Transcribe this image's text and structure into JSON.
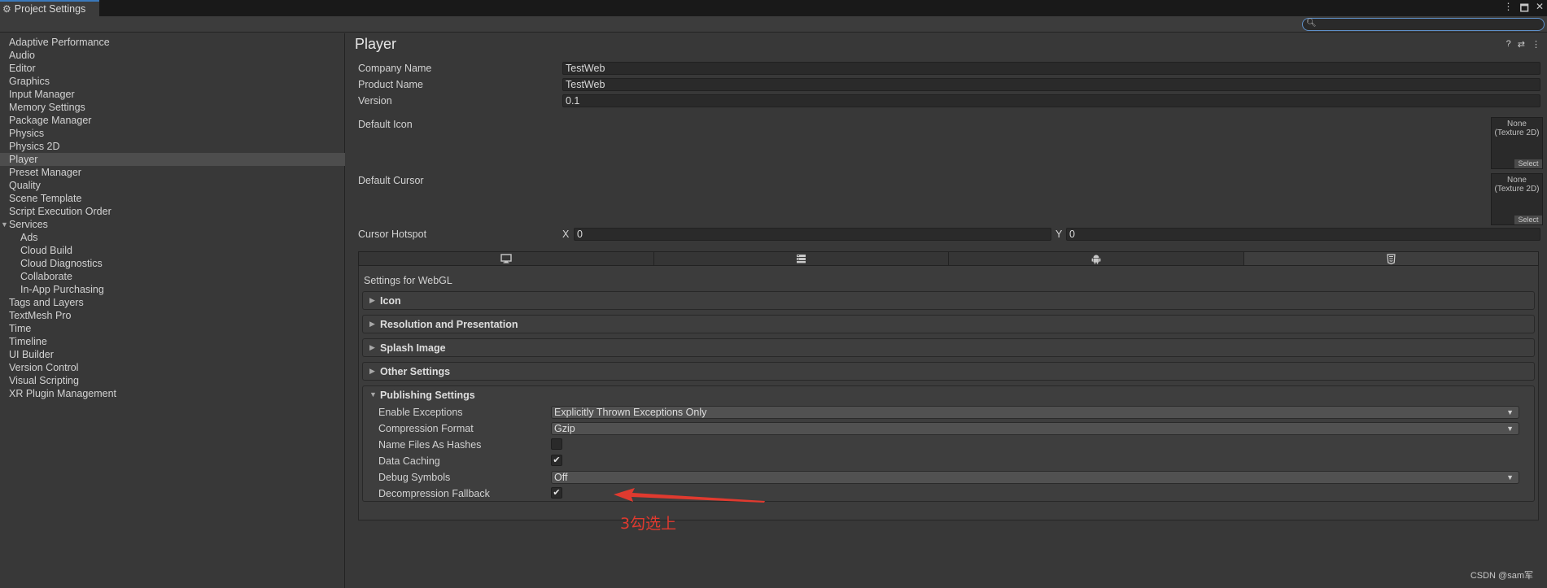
{
  "window": {
    "tab_title": "Project Settings",
    "controls": [
      "⋮",
      "🗖",
      "✕"
    ]
  },
  "search": {
    "placeholder": ""
  },
  "sidebar": {
    "items": [
      {
        "label": "Adaptive Performance"
      },
      {
        "label": "Audio"
      },
      {
        "label": "Editor"
      },
      {
        "label": "Graphics"
      },
      {
        "label": "Input Manager"
      },
      {
        "label": "Memory Settings"
      },
      {
        "label": "Package Manager"
      },
      {
        "label": "Physics"
      },
      {
        "label": "Physics 2D"
      },
      {
        "label": "Player",
        "selected": true
      },
      {
        "label": "Preset Manager"
      },
      {
        "label": "Quality"
      },
      {
        "label": "Scene Template"
      },
      {
        "label": "Script Execution Order"
      },
      {
        "label": "Services",
        "expanded": true
      },
      {
        "label": "Ads",
        "child": true
      },
      {
        "label": "Cloud Build",
        "child": true
      },
      {
        "label": "Cloud Diagnostics",
        "child": true
      },
      {
        "label": "Collaborate",
        "child": true
      },
      {
        "label": "In-App Purchasing",
        "child": true
      },
      {
        "label": "Tags and Layers"
      },
      {
        "label": "TextMesh Pro"
      },
      {
        "label": "Time"
      },
      {
        "label": "Timeline"
      },
      {
        "label": "UI Builder"
      },
      {
        "label": "Version Control"
      },
      {
        "label": "Visual Scripting"
      },
      {
        "label": "XR Plugin Management"
      }
    ]
  },
  "main": {
    "title": "Player",
    "title_icons": [
      "help-icon",
      "presets-icon",
      "more-icon"
    ],
    "company_name_label": "Company Name",
    "company_name": "TestWeb",
    "product_name_label": "Product Name",
    "product_name": "TestWeb",
    "version_label": "Version",
    "version": "0.1",
    "default_icon_label": "Default Icon",
    "default_cursor_label": "Default Cursor",
    "texture_none": "None\n(Texture 2D)",
    "texture_select": "Select",
    "cursor_hotspot_label": "Cursor Hotspot",
    "hotspot_x_label": "X",
    "hotspot_x": "0",
    "hotspot_y_label": "Y",
    "hotspot_y": "0",
    "platform_tabs": [
      "desktop-icon",
      "server-icon",
      "android-icon",
      "webgl-icon"
    ],
    "settings_for": "Settings for WebGL",
    "sections": {
      "icon": "Icon",
      "resolution": "Resolution and Presentation",
      "splash": "Splash Image",
      "other": "Other Settings",
      "publishing": "Publishing Settings"
    },
    "publishing": {
      "enable_exceptions_label": "Enable Exceptions",
      "enable_exceptions": "Explicitly Thrown Exceptions Only",
      "compression_format_label": "Compression Format",
      "compression_format": "Gzip",
      "name_files_as_hashes_label": "Name Files As Hashes",
      "name_files_as_hashes": false,
      "data_caching_label": "Data Caching",
      "data_caching": true,
      "debug_symbols_label": "Debug Symbols",
      "debug_symbols": "Off",
      "decompression_fallback_label": "Decompression Fallback",
      "decompression_fallback": true
    }
  },
  "annotation": {
    "text": "3勾选上",
    "color": "#e03a2f"
  },
  "watermark": "CSDN @sam军"
}
